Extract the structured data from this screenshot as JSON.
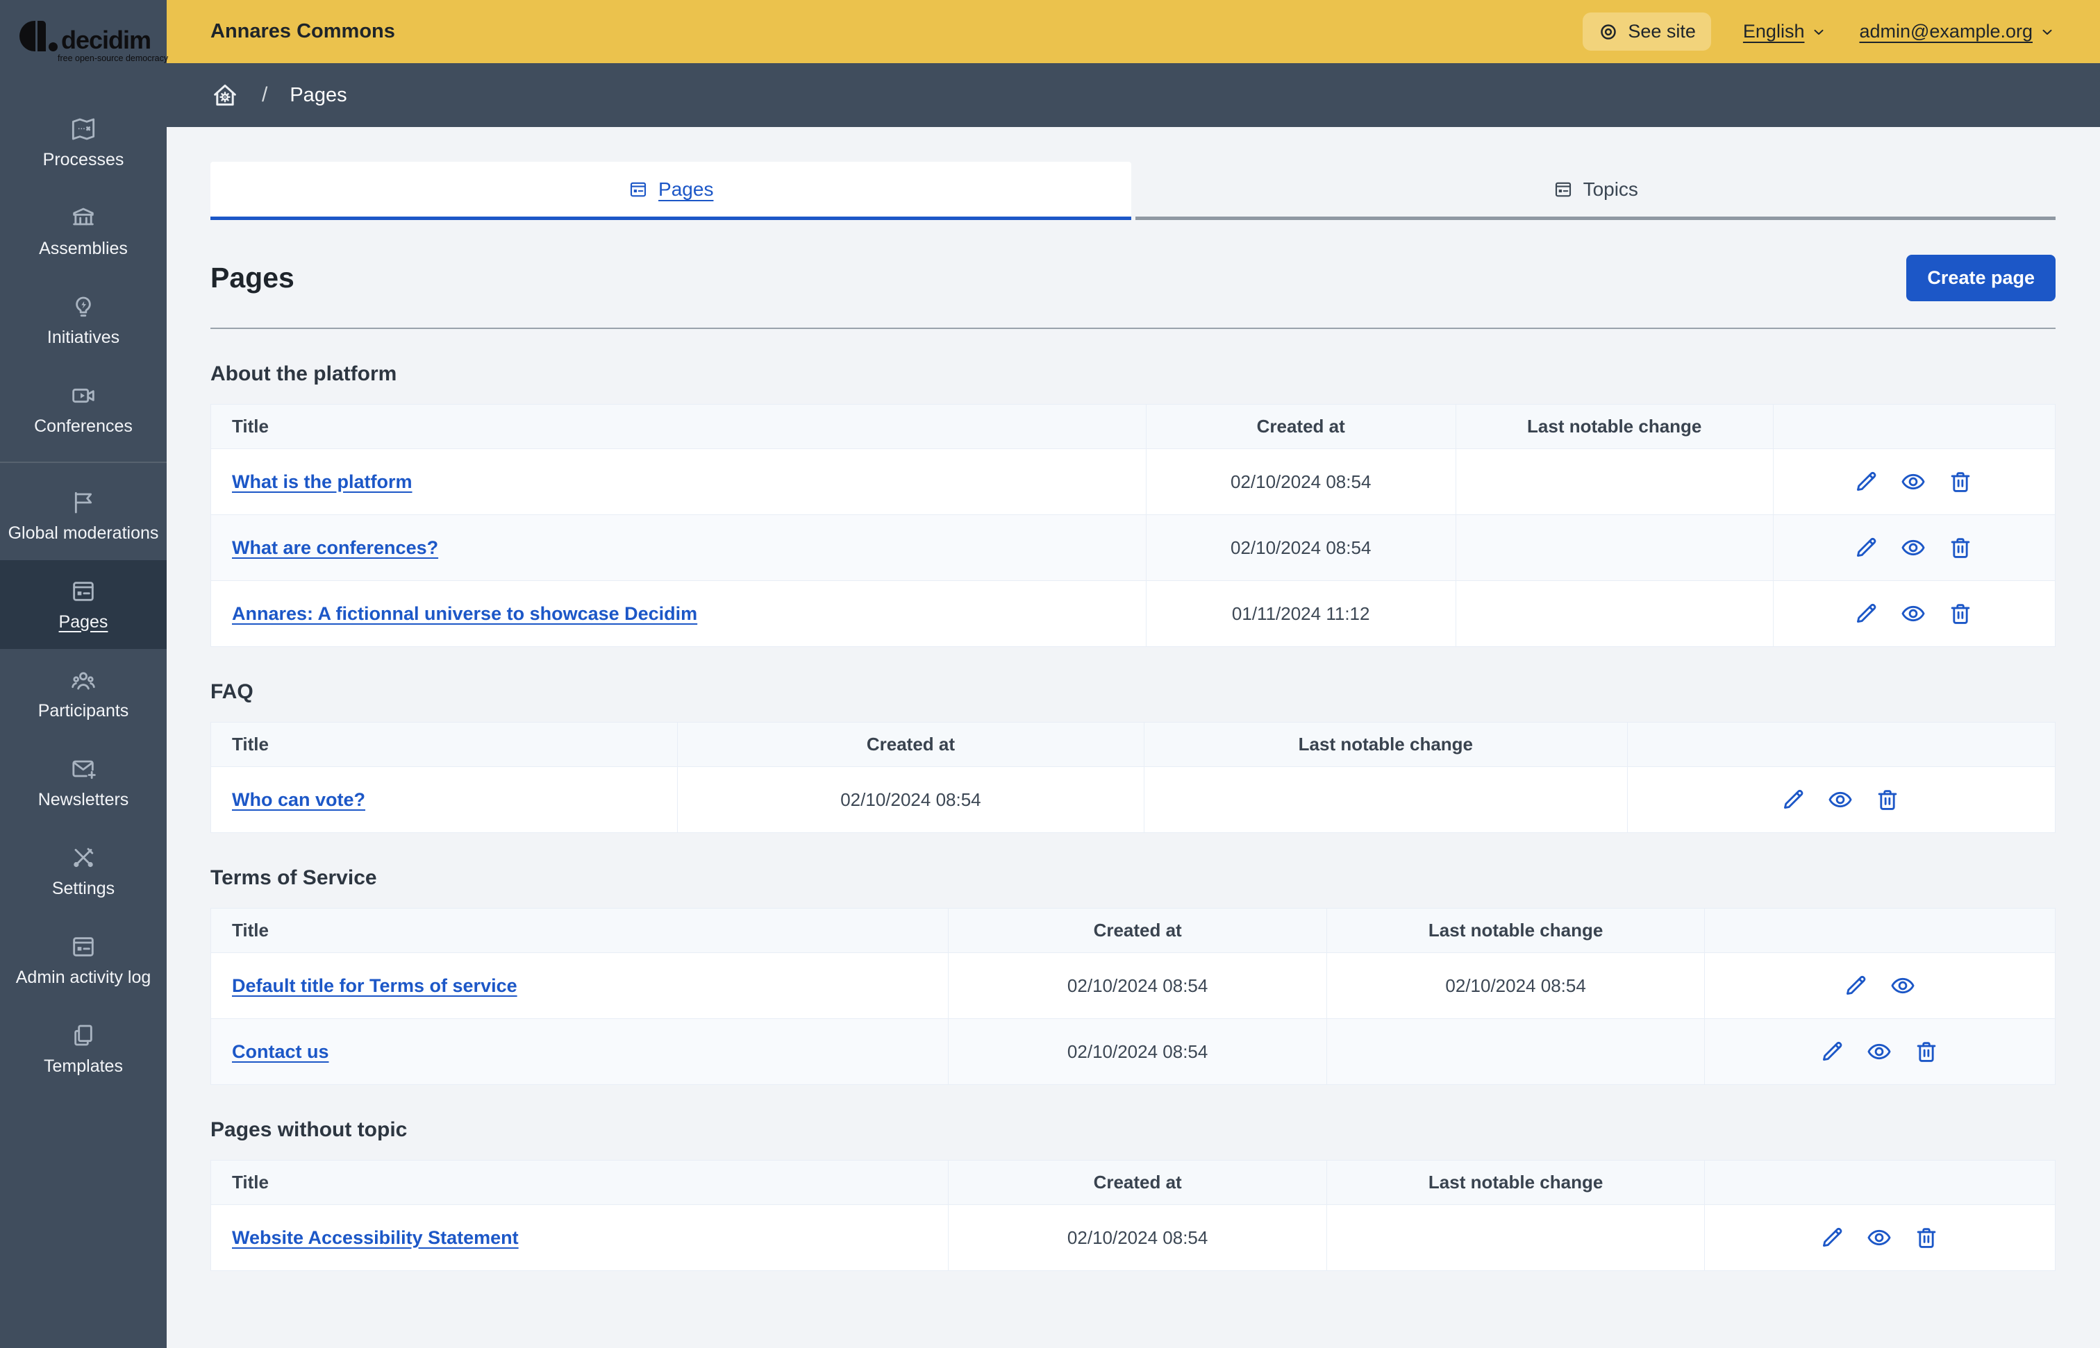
{
  "logo": {
    "name": "decidim",
    "tagline": "free open-source democracy"
  },
  "topbar": {
    "title": "Annares Commons",
    "see_site": "See site",
    "language": "English",
    "account": "admin@example.org"
  },
  "breadcrumb": {
    "current": "Pages"
  },
  "sidebar": {
    "items": [
      {
        "id": "processes",
        "label": "Processes",
        "icon": "map-icon"
      },
      {
        "id": "assemblies",
        "label": "Assemblies",
        "icon": "bank-icon"
      },
      {
        "id": "initiatives",
        "label": "Initiatives",
        "icon": "lightbulb-icon"
      },
      {
        "id": "conferences",
        "label": "Conferences",
        "icon": "video-icon"
      },
      {
        "id": "global-moderations",
        "label": "Global moderations",
        "icon": "flag-icon",
        "divider_before": true
      },
      {
        "id": "pages",
        "label": "Pages",
        "icon": "pages-icon",
        "active": true
      },
      {
        "id": "participants",
        "label": "Participants",
        "icon": "people-icon"
      },
      {
        "id": "newsletters",
        "label": "Newsletters",
        "icon": "mail-plus-icon"
      },
      {
        "id": "settings",
        "label": "Settings",
        "icon": "tools-icon"
      },
      {
        "id": "admin-activity-log",
        "label": "Admin activity log",
        "icon": "activity-log-icon"
      },
      {
        "id": "templates",
        "label": "Templates",
        "icon": "templates-icon"
      }
    ]
  },
  "tabs": [
    {
      "id": "pages",
      "label": "Pages",
      "icon": "pages-icon",
      "active": true
    },
    {
      "id": "topics",
      "label": "Topics",
      "icon": "pages-icon",
      "active": false
    }
  ],
  "page": {
    "title": "Pages",
    "create_button": "Create page"
  },
  "sections": [
    {
      "heading": "About the platform",
      "columns": [
        "Title",
        "Created at",
        "Last notable change"
      ],
      "col_widths": [
        "50.7%",
        "16.8%",
        "17.2%",
        "15.3%"
      ],
      "rows": [
        {
          "title": "What is the platform",
          "created_at": "02/10/2024 08:54",
          "last_change": "",
          "actions": [
            "edit",
            "preview",
            "delete"
          ]
        },
        {
          "title": "What are conferences?",
          "created_at": "02/10/2024 08:54",
          "last_change": "",
          "actions": [
            "edit",
            "preview",
            "delete"
          ]
        },
        {
          "title": "Annares: A fictionnal universe to showcase Decidim",
          "created_at": "01/11/2024 11:12",
          "last_change": "",
          "actions": [
            "edit",
            "preview",
            "delete"
          ]
        }
      ]
    },
    {
      "heading": "FAQ",
      "columns": [
        "Title",
        "Created at",
        "Last notable change"
      ],
      "col_widths": [
        "25.3%",
        "25.3%",
        "26.2%",
        "23.2%"
      ],
      "rows": [
        {
          "title": "Who can vote?",
          "created_at": "02/10/2024 08:54",
          "last_change": "",
          "actions": [
            "edit",
            "preview",
            "delete"
          ]
        }
      ]
    },
    {
      "heading": "Terms of Service",
      "columns": [
        "Title",
        "Created at",
        "Last notable change"
      ],
      "col_widths": [
        "40%",
        "20.5%",
        "20.5%",
        "19%"
      ],
      "rows": [
        {
          "title": "Default title for Terms of service",
          "created_at": "02/10/2024 08:54",
          "last_change": "02/10/2024 08:54",
          "actions": [
            "edit",
            "preview"
          ]
        },
        {
          "title": "Contact us",
          "created_at": "02/10/2024 08:54",
          "last_change": "",
          "actions": [
            "edit",
            "preview",
            "delete"
          ]
        }
      ]
    },
    {
      "heading": "Pages without topic",
      "columns": [
        "Title",
        "Created at",
        "Last notable change"
      ],
      "col_widths": [
        "40%",
        "20.5%",
        "20.5%",
        "19%"
      ],
      "rows": [
        {
          "title": "Website Accessibility Statement",
          "created_at": "02/10/2024 08:54",
          "last_change": "",
          "actions": [
            "edit",
            "preview",
            "delete"
          ]
        }
      ]
    }
  ],
  "colors": {
    "accent_blue": "#1c57c7",
    "topbar_yellow": "#ebc24d",
    "sidebar_slate": "#404d5d"
  }
}
